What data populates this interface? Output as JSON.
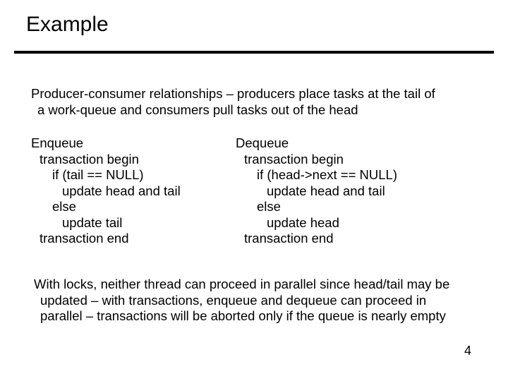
{
  "title": "Example",
  "intro": {
    "line1": "Producer-consumer relationships – producers place tasks at the tail of",
    "line2": "a work-queue and consumers pull tasks out of the head"
  },
  "enqueue": {
    "name": "Enqueue",
    "l1": "transaction begin",
    "l2": "if (tail == NULL)",
    "l3": "update head and tail",
    "l4": "else",
    "l5": "update tail",
    "l6": "transaction end"
  },
  "dequeue": {
    "name": "Dequeue",
    "l1": "transaction begin",
    "l2": "if (head->next == NULL)",
    "l3": "update head and tail",
    "l4": "else",
    "l5": "update head",
    "l6": "transaction end"
  },
  "summary": {
    "line1": "With locks, neither thread can proceed in parallel since head/tail may be",
    "line2": "updated – with transactions, enqueue and dequeue can proceed in",
    "line3": "parallel – transactions will be aborted only if the queue is nearly empty"
  },
  "page_number": "4"
}
